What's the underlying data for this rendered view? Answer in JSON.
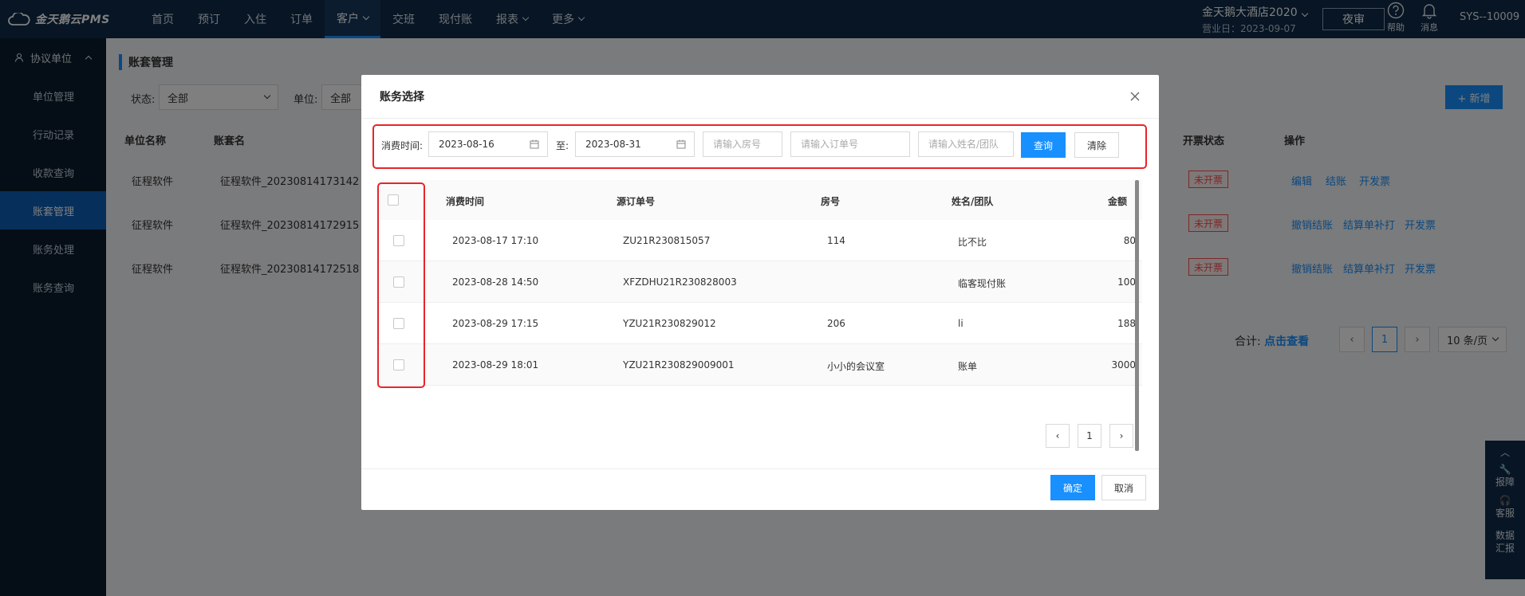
{
  "brand": {
    "logo_text": "金天鹅云PMS"
  },
  "nav": {
    "items": [
      "首页",
      "预订",
      "入住",
      "订单",
      "客户",
      "交班",
      "现付账",
      "报表",
      "更多"
    ]
  },
  "header": {
    "hotel_name": "金天鹅大酒店2020",
    "business_date": "营业日：2023-09-07",
    "night_audit": "夜审",
    "help": "帮助",
    "messages": "消息",
    "user": "SYS--10009"
  },
  "sidebar": {
    "group": "协议单位",
    "items": [
      "单位管理",
      "行动记录",
      "收款查询",
      "账套管理",
      "账务处理",
      "账务查询"
    ]
  },
  "page": {
    "title": "账套管理",
    "status_label": "状态:",
    "status_value": "全部",
    "unit_label": "单位:",
    "unit_value": "全部",
    "add_button": "+ 新增",
    "columns": [
      "单位名称",
      "账套名",
      "开票状态",
      "操作"
    ],
    "rows": [
      {
        "unit": "征程软件",
        "account": "征程软件_20230814173142",
        "status": "未开票",
        "actions": [
          "编辑",
          "结账",
          "开发票"
        ]
      },
      {
        "unit": "征程软件",
        "account": "征程软件_20230814172915",
        "status": "未开票",
        "actions": [
          "撤销结账",
          "结算单补打",
          "开发票"
        ]
      },
      {
        "unit": "征程软件",
        "account": "征程软件_20230814172518",
        "status": "未开票",
        "actions": [
          "撤销结账",
          "结算单补打",
          "开发票"
        ]
      }
    ],
    "total_label": "合计:",
    "total_link": "点击查看",
    "page_current": "1",
    "page_size": "10 条/页"
  },
  "float_panel": {
    "report": "报障",
    "service": "客服",
    "data": "数据",
    "report2": "汇报"
  },
  "dialog": {
    "title": "账务选择",
    "search": {
      "time_label": "消费时间:",
      "start_date": "2023-08-16",
      "to_label": "至:",
      "end_date": "2023-08-31",
      "room_placeholder": "请输入房号",
      "order_placeholder": "请输入订单号",
      "name_placeholder": "请输入姓名/团队",
      "query_button": "查询",
      "clear_button": "清除"
    },
    "table": {
      "headers": [
        "消费时间",
        "源订单号",
        "房号",
        "姓名/团队",
        "金额"
      ],
      "rows": [
        {
          "time": "2023-08-17 17:10",
          "order": "ZU21R230815057",
          "room": "114",
          "name": "比不比",
          "amount": "80"
        },
        {
          "time": "2023-08-28 14:50",
          "order": "XFZDHU21R230828003",
          "room": "",
          "name": "临客现付账",
          "amount": "100"
        },
        {
          "time": "2023-08-29 17:15",
          "order": "YZU21R230829012",
          "room": "206",
          "name": "li",
          "amount": "188"
        },
        {
          "time": "2023-08-29 18:01",
          "order": "YZU21R230829009001",
          "room": "小小的会议室",
          "name": "账单",
          "amount": "3000"
        }
      ]
    },
    "pagination": {
      "current": "1"
    },
    "confirm_button": "确定",
    "cancel_button": "取消"
  },
  "colors": {
    "primary": "#1890ff",
    "nav_bg": "#0e2b49",
    "sidebar_bg": "#0b1c2d",
    "highlight": "#e8242b",
    "danger": "#ff4d4f"
  }
}
